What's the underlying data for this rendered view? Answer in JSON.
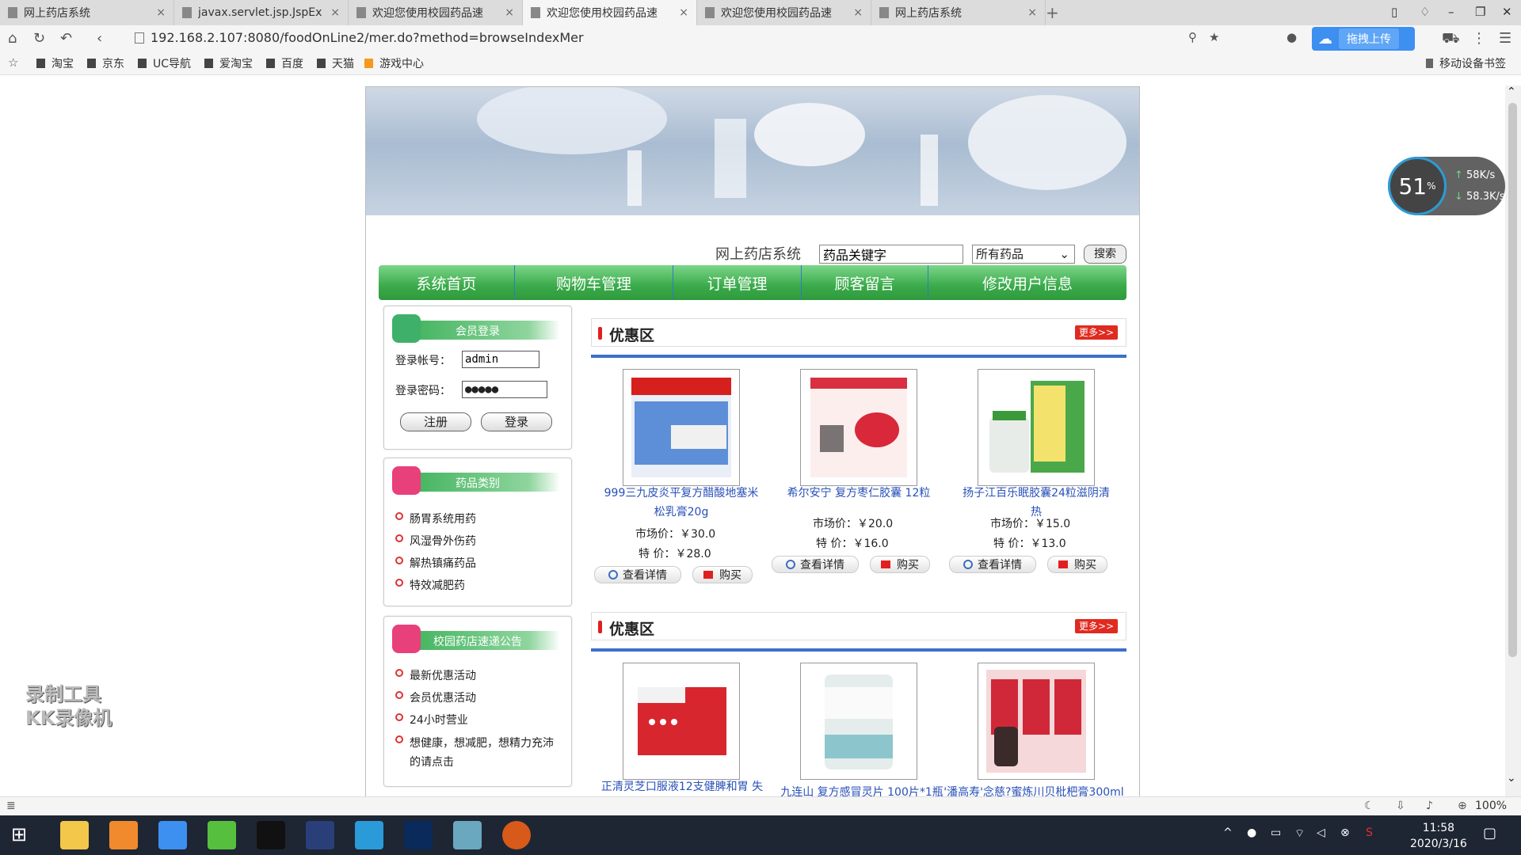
{
  "browser": {
    "tabs": [
      {
        "title": "网上药店系统",
        "active": false
      },
      {
        "title": "javax.servlet.jsp.JspEx",
        "active": false
      },
      {
        "title": "欢迎您使用校园药品速",
        "active": false
      },
      {
        "title": "欢迎您使用校园药品速",
        "active": true
      },
      {
        "title": "欢迎您使用校园药品速",
        "active": false
      },
      {
        "title": "网上药店系统",
        "active": false
      }
    ],
    "url": "192.168.2.107:8080/foodOnLine2/mer.do?method=browseIndexMer",
    "upload_label": "拖拽上传",
    "bookmarks": [
      "淘宝",
      "京东",
      "UC导航",
      "爱淘宝",
      "百度",
      "天猫",
      "游戏中心"
    ],
    "mobile_bookmarks": "移动设备书签",
    "zoom": "100%"
  },
  "site": {
    "search_label": "网上药店系统",
    "search_value": "药品关键字",
    "category_selected": "所有药品",
    "search_button": "搜索",
    "nav": [
      "系统首页",
      "购物车管理",
      "订单管理",
      "顾客留言",
      "修改用户信息"
    ]
  },
  "login": {
    "title": "会员登录",
    "account_label": "登录帐号：",
    "account_value": "admin",
    "password_label": "登录密码：",
    "password_value": "●●●●●",
    "register_button": "注册",
    "login_button": "登录"
  },
  "categories": {
    "title": "药品类别",
    "items": [
      "肠胃系统用药",
      "风湿骨外伤药",
      "解热镇痛药品",
      "特效减肥药"
    ]
  },
  "notices": {
    "title": "校园药店速递公告",
    "items": [
      "最新优惠活动",
      "会员优惠活动",
      "24小时营业",
      "想健康，想减肥，想精力充沛的请点击"
    ]
  },
  "sections": [
    {
      "title": "优惠区",
      "more": "更多>>",
      "products": [
        {
          "name": "999三九皮炎平复方醋酸地塞米松乳膏20g",
          "market_label": "市场价：",
          "market_price": "￥30.0",
          "special_label": "特  价：",
          "special_price": "￥28.0",
          "detail": "查看详情",
          "buy": "购买",
          "img_color": "#4a7fd0"
        },
        {
          "name": "希尔安宁 复方枣仁胶囊 12粒",
          "market_label": "市场价：",
          "market_price": "￥20.0",
          "special_label": "特  价：",
          "special_price": "￥16.0",
          "detail": "查看详情",
          "buy": "购买",
          "img_color": "#d83040"
        },
        {
          "name": "扬子江百乐眠胶囊24粒滋阴清热",
          "market_label": "市场价：",
          "market_price": "￥15.0",
          "special_label": "特  价：",
          "special_price": "￥13.0",
          "detail": "查看详情",
          "buy": "购买",
          "img_color": "#3aa84a"
        }
      ]
    },
    {
      "title": "优惠区",
      "more": "更多>>",
      "products": [
        {
          "name": "正清灵芝口服液12支健脾和胃 失",
          "img_color": "#d8262e"
        },
        {
          "name": "九连山 复方感冒灵片 100片*1瓶",
          "img_color": "#5aa0b0"
        },
        {
          "name": "'潘高寿'念慈?蜜炼川贝枇杷膏300ml",
          "img_color": "#c02030"
        }
      ]
    }
  ],
  "overlay": {
    "cpu": "51",
    "cpu_unit": "%",
    "up_speed": "58K/s",
    "down_speed": "58.3K/s",
    "watermark_line1": "录制工具",
    "watermark_line2": "KK录像机"
  },
  "taskbar": {
    "time": "11:58",
    "date": "2020/3/16"
  }
}
